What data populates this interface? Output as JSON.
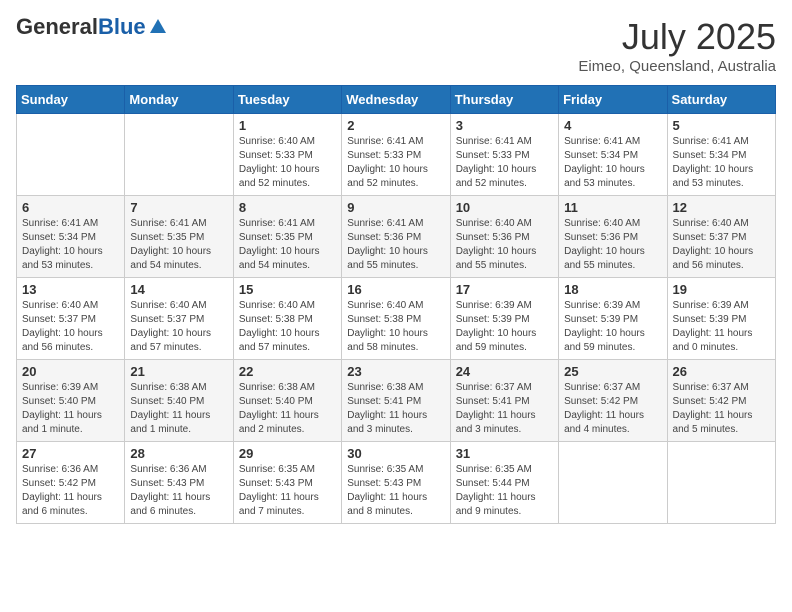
{
  "header": {
    "logo_general": "General",
    "logo_blue": "Blue",
    "month": "July 2025",
    "location": "Eimeo, Queensland, Australia"
  },
  "days_of_week": [
    "Sunday",
    "Monday",
    "Tuesday",
    "Wednesday",
    "Thursday",
    "Friday",
    "Saturday"
  ],
  "weeks": [
    [
      {
        "day": "",
        "info": ""
      },
      {
        "day": "",
        "info": ""
      },
      {
        "day": "1",
        "info": "Sunrise: 6:40 AM\nSunset: 5:33 PM\nDaylight: 10 hours\nand 52 minutes."
      },
      {
        "day": "2",
        "info": "Sunrise: 6:41 AM\nSunset: 5:33 PM\nDaylight: 10 hours\nand 52 minutes."
      },
      {
        "day": "3",
        "info": "Sunrise: 6:41 AM\nSunset: 5:33 PM\nDaylight: 10 hours\nand 52 minutes."
      },
      {
        "day": "4",
        "info": "Sunrise: 6:41 AM\nSunset: 5:34 PM\nDaylight: 10 hours\nand 53 minutes."
      },
      {
        "day": "5",
        "info": "Sunrise: 6:41 AM\nSunset: 5:34 PM\nDaylight: 10 hours\nand 53 minutes."
      }
    ],
    [
      {
        "day": "6",
        "info": "Sunrise: 6:41 AM\nSunset: 5:34 PM\nDaylight: 10 hours\nand 53 minutes."
      },
      {
        "day": "7",
        "info": "Sunrise: 6:41 AM\nSunset: 5:35 PM\nDaylight: 10 hours\nand 54 minutes."
      },
      {
        "day": "8",
        "info": "Sunrise: 6:41 AM\nSunset: 5:35 PM\nDaylight: 10 hours\nand 54 minutes."
      },
      {
        "day": "9",
        "info": "Sunrise: 6:41 AM\nSunset: 5:36 PM\nDaylight: 10 hours\nand 55 minutes."
      },
      {
        "day": "10",
        "info": "Sunrise: 6:40 AM\nSunset: 5:36 PM\nDaylight: 10 hours\nand 55 minutes."
      },
      {
        "day": "11",
        "info": "Sunrise: 6:40 AM\nSunset: 5:36 PM\nDaylight: 10 hours\nand 55 minutes."
      },
      {
        "day": "12",
        "info": "Sunrise: 6:40 AM\nSunset: 5:37 PM\nDaylight: 10 hours\nand 56 minutes."
      }
    ],
    [
      {
        "day": "13",
        "info": "Sunrise: 6:40 AM\nSunset: 5:37 PM\nDaylight: 10 hours\nand 56 minutes."
      },
      {
        "day": "14",
        "info": "Sunrise: 6:40 AM\nSunset: 5:37 PM\nDaylight: 10 hours\nand 57 minutes."
      },
      {
        "day": "15",
        "info": "Sunrise: 6:40 AM\nSunset: 5:38 PM\nDaylight: 10 hours\nand 57 minutes."
      },
      {
        "day": "16",
        "info": "Sunrise: 6:40 AM\nSunset: 5:38 PM\nDaylight: 10 hours\nand 58 minutes."
      },
      {
        "day": "17",
        "info": "Sunrise: 6:39 AM\nSunset: 5:39 PM\nDaylight: 10 hours\nand 59 minutes."
      },
      {
        "day": "18",
        "info": "Sunrise: 6:39 AM\nSunset: 5:39 PM\nDaylight: 10 hours\nand 59 minutes."
      },
      {
        "day": "19",
        "info": "Sunrise: 6:39 AM\nSunset: 5:39 PM\nDaylight: 11 hours\nand 0 minutes."
      }
    ],
    [
      {
        "day": "20",
        "info": "Sunrise: 6:39 AM\nSunset: 5:40 PM\nDaylight: 11 hours\nand 1 minute."
      },
      {
        "day": "21",
        "info": "Sunrise: 6:38 AM\nSunset: 5:40 PM\nDaylight: 11 hours\nand 1 minute."
      },
      {
        "day": "22",
        "info": "Sunrise: 6:38 AM\nSunset: 5:40 PM\nDaylight: 11 hours\nand 2 minutes."
      },
      {
        "day": "23",
        "info": "Sunrise: 6:38 AM\nSunset: 5:41 PM\nDaylight: 11 hours\nand 3 minutes."
      },
      {
        "day": "24",
        "info": "Sunrise: 6:37 AM\nSunset: 5:41 PM\nDaylight: 11 hours\nand 3 minutes."
      },
      {
        "day": "25",
        "info": "Sunrise: 6:37 AM\nSunset: 5:42 PM\nDaylight: 11 hours\nand 4 minutes."
      },
      {
        "day": "26",
        "info": "Sunrise: 6:37 AM\nSunset: 5:42 PM\nDaylight: 11 hours\nand 5 minutes."
      }
    ],
    [
      {
        "day": "27",
        "info": "Sunrise: 6:36 AM\nSunset: 5:42 PM\nDaylight: 11 hours\nand 6 minutes."
      },
      {
        "day": "28",
        "info": "Sunrise: 6:36 AM\nSunset: 5:43 PM\nDaylight: 11 hours\nand 6 minutes."
      },
      {
        "day": "29",
        "info": "Sunrise: 6:35 AM\nSunset: 5:43 PM\nDaylight: 11 hours\nand 7 minutes."
      },
      {
        "day": "30",
        "info": "Sunrise: 6:35 AM\nSunset: 5:43 PM\nDaylight: 11 hours\nand 8 minutes."
      },
      {
        "day": "31",
        "info": "Sunrise: 6:35 AM\nSunset: 5:44 PM\nDaylight: 11 hours\nand 9 minutes."
      },
      {
        "day": "",
        "info": ""
      },
      {
        "day": "",
        "info": ""
      }
    ]
  ]
}
